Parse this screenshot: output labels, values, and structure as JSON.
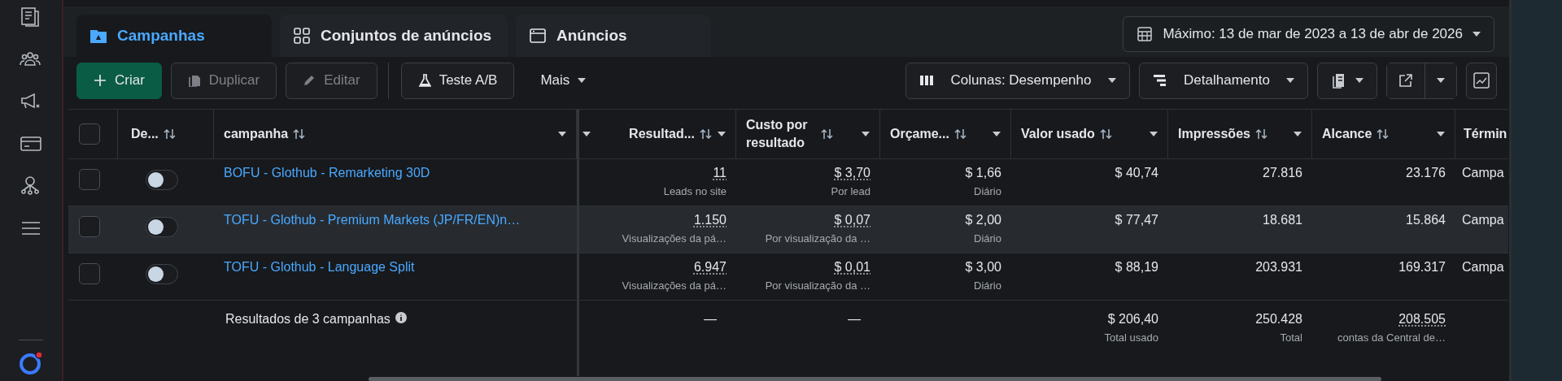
{
  "tabs": [
    {
      "label": "Campanhas",
      "selected": true
    },
    {
      "label": "Conjuntos de anúncios",
      "selected": false
    },
    {
      "label": "Anúncios",
      "selected": false
    }
  ],
  "date_range": {
    "label": "Máximo: 13 de mar de 2023 a 13 de abr de 2026"
  },
  "actions": [
    {
      "label": "Criar",
      "kind": "primary",
      "disabled": false
    },
    {
      "label": "Duplicar",
      "kind": "duplicate",
      "disabled": true
    },
    {
      "label": "Editar",
      "kind": "edit",
      "disabled": true
    },
    {
      "label": "Teste A/B",
      "kind": "test",
      "disabled": false
    },
    {
      "label": "Mais",
      "kind": "menu",
      "disabled": false
    }
  ],
  "view_controls": [
    {
      "label": "Colunas: Desempenho",
      "kind": "columns"
    },
    {
      "label": "Detalhamento",
      "kind": "breakdown"
    }
  ],
  "table": {
    "all_selected": false,
    "columns": [
      "De...",
      "campanha",
      "Resultad...",
      "Custo por resultado",
      "Orçame...",
      "Valor usado",
      "Impressões",
      "Alcance",
      "Términ"
    ],
    "rows": [
      {
        "selected": false,
        "on": false,
        "hovered": false,
        "name": "BOFU - Glothub - Remarketing 30D",
        "results": "11",
        "results_label": "Leads no site",
        "cost": "$ 3,70",
        "cost_label": "Por lead",
        "budget": "$ 1,66",
        "budget_label": "Diário",
        "spent": "$ 40,74",
        "impressions": "27.816",
        "reach": "23.176",
        "end": "Campa"
      },
      {
        "selected": false,
        "on": false,
        "hovered": true,
        "name": "TOFU - Glothub - Premium Markets (JP/FR/EN)n…",
        "results": "1.150",
        "results_label": "Visualizações da pá…",
        "cost": "$ 0,07",
        "cost_label": "Por visualização da …",
        "budget": "$ 2,00",
        "budget_label": "Diário",
        "spent": "$ 77,47",
        "impressions": "18.681",
        "reach": "15.864",
        "end": "Campa"
      },
      {
        "selected": false,
        "on": false,
        "hovered": false,
        "name": "TOFU - Glothub - Language Split",
        "results": "6.947",
        "results_label": "Visualizações da pá…",
        "cost": "$ 0,01",
        "cost_label": "Por visualização da …",
        "budget": "$ 3,00",
        "budget_label": "Diário",
        "spent": "$ 88,19",
        "impressions": "203.931",
        "reach": "169.317",
        "end": "Campa"
      }
    ],
    "totals": {
      "label": "Resultados de 3 campanhas",
      "results": "—",
      "cost": "—",
      "spent": "$ 206,40",
      "spent_label": "Total usado",
      "impressions": "250.428",
      "impressions_label": "Total",
      "reach": "208.505",
      "reach_label": "contas da Central de…"
    }
  }
}
